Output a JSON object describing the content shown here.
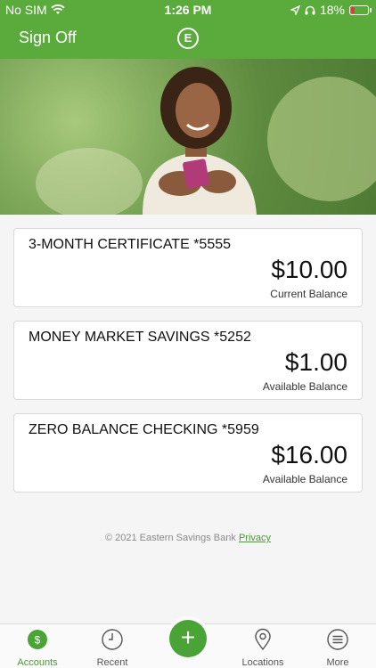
{
  "status_bar": {
    "carrier": "No SIM",
    "time": "1:26 PM",
    "battery": "18%",
    "battery_level": 0.18
  },
  "header": {
    "sign_off_label": "Sign Off",
    "logo_letter": "E"
  },
  "accounts": [
    {
      "name": "3-MONTH CERTIFICATE *5555",
      "amount": "$10.00",
      "balance_label": "Current Balance"
    },
    {
      "name": "MONEY MARKET SAVINGS *5252",
      "amount": "$1.00",
      "balance_label": "Available Balance"
    },
    {
      "name": "ZERO BALANCE CHECKING *5959",
      "amount": "$16.00",
      "balance_label": "Available Balance"
    }
  ],
  "footer": {
    "copyright": "© 2021 Eastern Savings Bank",
    "privacy_link": "Privacy"
  },
  "tabbar": {
    "accounts_label": "Accounts",
    "recent_label": "Recent",
    "add_symbol": "+",
    "locations_label": "Locations",
    "more_label": "More"
  },
  "colors": {
    "brand_green": "#5aaa3c",
    "link_green": "#4a9a33"
  }
}
